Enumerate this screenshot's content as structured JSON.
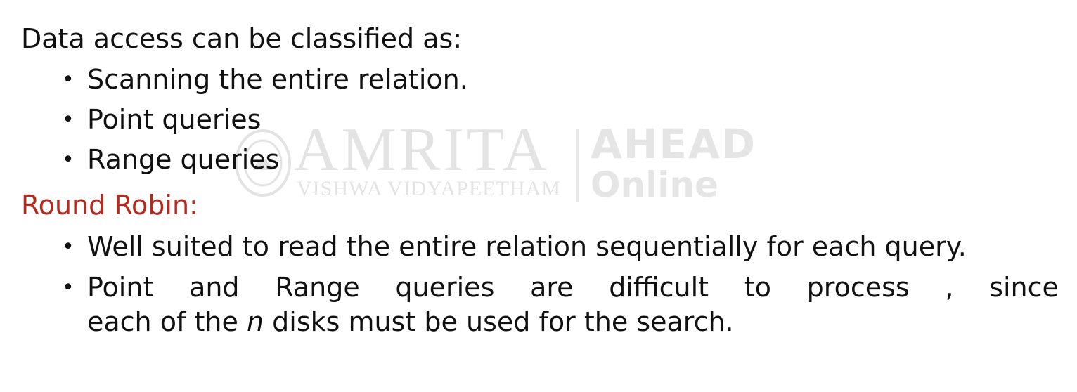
{
  "section1": {
    "heading": "Data access can be classified as:",
    "items": [
      "Scanning the entire relation.",
      "Point queries",
      "Range queries"
    ]
  },
  "section2": {
    "heading": "Round Robin:",
    "heading_color": "#b52a1f",
    "items": [
      "Well suited to read the entire relation sequentially for each query.",
      "Point and Range queries are difficult to process , since each of the n disks must be used for the search."
    ]
  },
  "watermark": {
    "brand": "AMRITA",
    "sub": "VISHWA VIDYAPEETHAM",
    "ahead": "AHEAD",
    "online": "Online"
  }
}
